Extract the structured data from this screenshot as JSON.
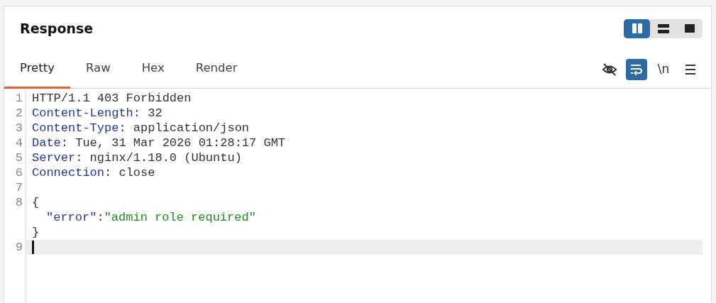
{
  "title": "Response",
  "layout_buttons": [
    {
      "kind": "columns",
      "selected": true
    },
    {
      "kind": "rows",
      "selected": false
    },
    {
      "kind": "single",
      "selected": false
    }
  ],
  "tabs": [
    {
      "label": "Pretty",
      "selected": true
    },
    {
      "label": "Raw",
      "selected": false
    },
    {
      "label": "Hex",
      "selected": false
    },
    {
      "label": "Render",
      "selected": false
    }
  ],
  "toolbar": [
    {
      "kind": "eye-off",
      "selected": false
    },
    {
      "kind": "wrap",
      "selected": true
    },
    {
      "kind": "newline",
      "label": "\\n",
      "selected": false
    },
    {
      "kind": "menu",
      "selected": false
    }
  ],
  "lines": [
    {
      "number": "1",
      "current": false,
      "rows": [
        {
          "indented": false,
          "spans": [
            {
              "kind": "plain",
              "text": "HTTP/1.1 403 Forbidden"
            }
          ]
        }
      ]
    },
    {
      "number": "2",
      "current": false,
      "rows": [
        {
          "indented": false,
          "spans": [
            {
              "kind": "key",
              "text": "Content-Length"
            },
            {
              "kind": "plain",
              "text": ": 32"
            }
          ]
        }
      ]
    },
    {
      "number": "3",
      "current": false,
      "rows": [
        {
          "indented": false,
          "spans": [
            {
              "kind": "key",
              "text": "Content-Type"
            },
            {
              "kind": "plain",
              "text": ": application/json"
            }
          ]
        }
      ]
    },
    {
      "number": "4",
      "current": false,
      "rows": [
        {
          "indented": false,
          "spans": [
            {
              "kind": "key",
              "text": "Date"
            },
            {
              "kind": "plain",
              "text": ": Tue, 31 Mar 2026 01:28:17 GMT"
            }
          ]
        }
      ]
    },
    {
      "number": "5",
      "current": false,
      "rows": [
        {
          "indented": false,
          "spans": [
            {
              "kind": "key",
              "text": "Server"
            },
            {
              "kind": "plain",
              "text": ": nginx/1.18.0 (Ubuntu)"
            }
          ]
        }
      ]
    },
    {
      "number": "6",
      "current": false,
      "rows": [
        {
          "indented": false,
          "spans": [
            {
              "kind": "key",
              "text": "Connection"
            },
            {
              "kind": "plain",
              "text": ": close"
            }
          ]
        }
      ]
    },
    {
      "number": "7",
      "current": false,
      "rows": [
        {}
      ]
    },
    {
      "number": "8",
      "current": false,
      "rows": [
        {
          "indented": false,
          "spans": [
            {
              "kind": "plain",
              "text": "{"
            }
          ]
        },
        {
          "indented": true,
          "spans": [
            {
              "kind": "key",
              "text": "\"error\""
            },
            {
              "kind": "plain",
              "text": ":"
            },
            {
              "kind": "string",
              "text": "\"admin role required\""
            }
          ]
        },
        {
          "indented": false,
          "spans": [
            {
              "kind": "plain",
              "text": "}"
            }
          ]
        }
      ]
    },
    {
      "number": "9",
      "current": true,
      "rows": [
        {}
      ]
    }
  ]
}
